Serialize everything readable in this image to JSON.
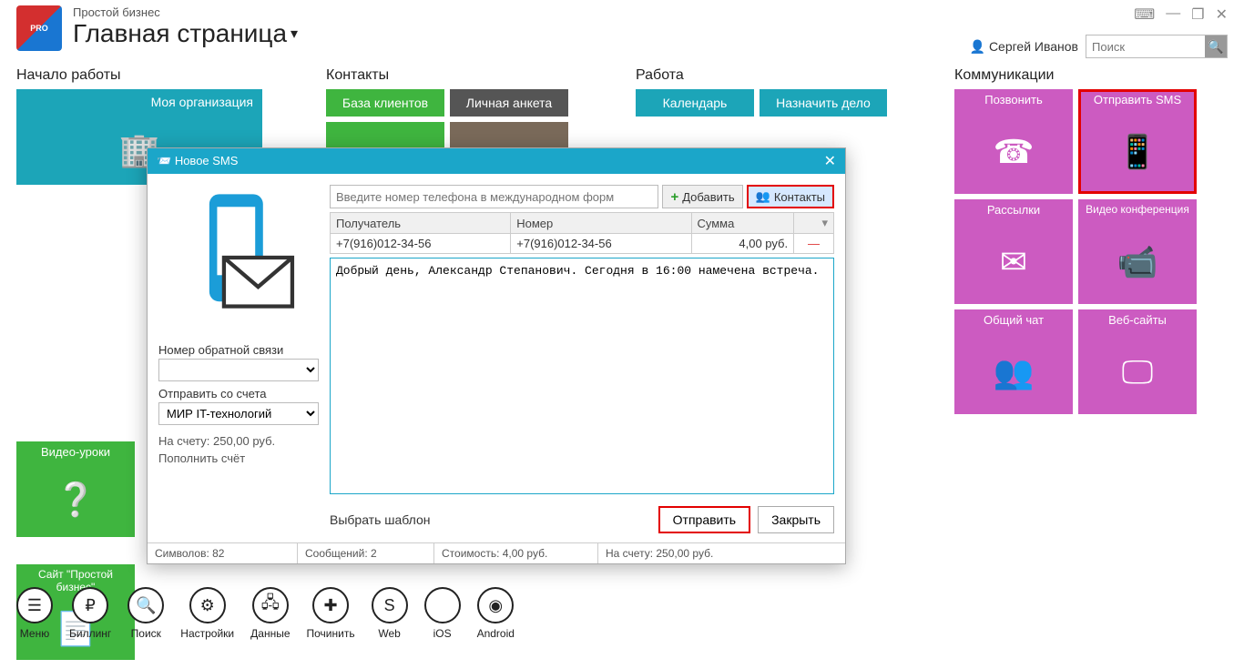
{
  "app_name": "Простой бизнес",
  "page_title": "Главная страница",
  "user_name": "Сергей Иванов",
  "search_placeholder": "Поиск",
  "sections": {
    "start": {
      "title": "Начало работы",
      "my_org": "Моя организация",
      "video_lessons": "Видео-уроки",
      "site": "Сайт \"Простой бизнес\""
    },
    "contacts": {
      "title": "Контакты",
      "client_db": "База клиентов",
      "personal": "Личная анкета"
    },
    "work": {
      "title": "Работа",
      "calendar": "Календарь",
      "assign": "Назначить дело"
    },
    "comms": {
      "title": "Коммуникации",
      "call": "Позвонить",
      "send_sms": "Отправить SMS",
      "mailings": "Рассылки",
      "video_conf": "Видео конференция",
      "chat": "Общий чат",
      "websites": "Веб-сайты"
    }
  },
  "bottom_bar": {
    "menu": "Меню",
    "billing": "Биллинг",
    "search": "Поиск",
    "settings": "Настройки",
    "data": "Данные",
    "repair": "Починить",
    "web": "Web",
    "ios": "iOS",
    "android": "Android"
  },
  "dialog": {
    "title": "Новое SMS",
    "phone_placeholder": "Введите номер телефона в международном форм",
    "add_btn": "Добавить",
    "contacts_btn": "Контакты",
    "table": {
      "col_recipient": "Получатель",
      "col_number": "Номер",
      "col_sum": "Сумма",
      "row_recipient": "+7(916)012-34-56",
      "row_number": "+7(916)012-34-56",
      "row_sum": "4,00 руб."
    },
    "message": "Добрый день, Александр Степанович. Сегодня в 16:00 намечена встреча.",
    "callback_label": "Номер обратной связи",
    "callback_value": "",
    "account_label": "Отправить со счета",
    "account_value": "МИР IT-технологий",
    "balance_text": "На счету: 250,00 руб.",
    "topup_text": "Пополнить счёт",
    "template_label": "Выбрать шаблон",
    "send_btn": "Отправить",
    "close_btn": "Закрыть",
    "status": {
      "chars": "Символов: 82",
      "msgs": "Сообщений: 2",
      "cost": "Стоимость: 4,00 руб.",
      "balance": "На счету: 250,00 руб."
    }
  }
}
